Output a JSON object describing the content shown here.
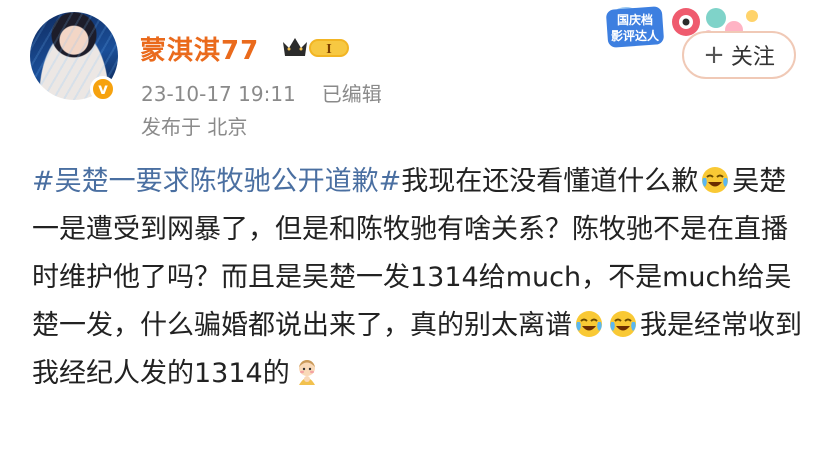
{
  "user": {
    "name": "蒙淇淇77",
    "level_badge": "I",
    "timestamp": "23-10-17 19:11",
    "edited": "已编辑",
    "location": "发布于 北京"
  },
  "event_badge": {
    "text_line1": "国庆档",
    "text_line2": "影评达人"
  },
  "follow_button": {
    "label": "关注"
  },
  "post": {
    "hashtag": "#吴楚一要求陈牧驰公开道歉#",
    "segment1": "我现在还没看懂道什么歉",
    "segment2": "吴楚一是遭受到网暴了，但是和陈牧驰有啥关系？陈牧驰不是在直播时维护他了吗？而且是吴楚一发1314给much，不是much给吴楚一发，什么骗婚都说出来了，真的别太离谱",
    "segment3": "我是经常收到我经纪人发的1314的",
    "emoji_names": [
      "laugh-cry-emoji",
      "laugh-cry-emoji",
      "laugh-cry-emoji",
      "shy-child-emoji"
    ]
  },
  "colors": {
    "username": "#ea6a1c",
    "hashtag": "#4a6fa1",
    "meta": "#8a8a8a",
    "verify": "#f6a20f"
  }
}
